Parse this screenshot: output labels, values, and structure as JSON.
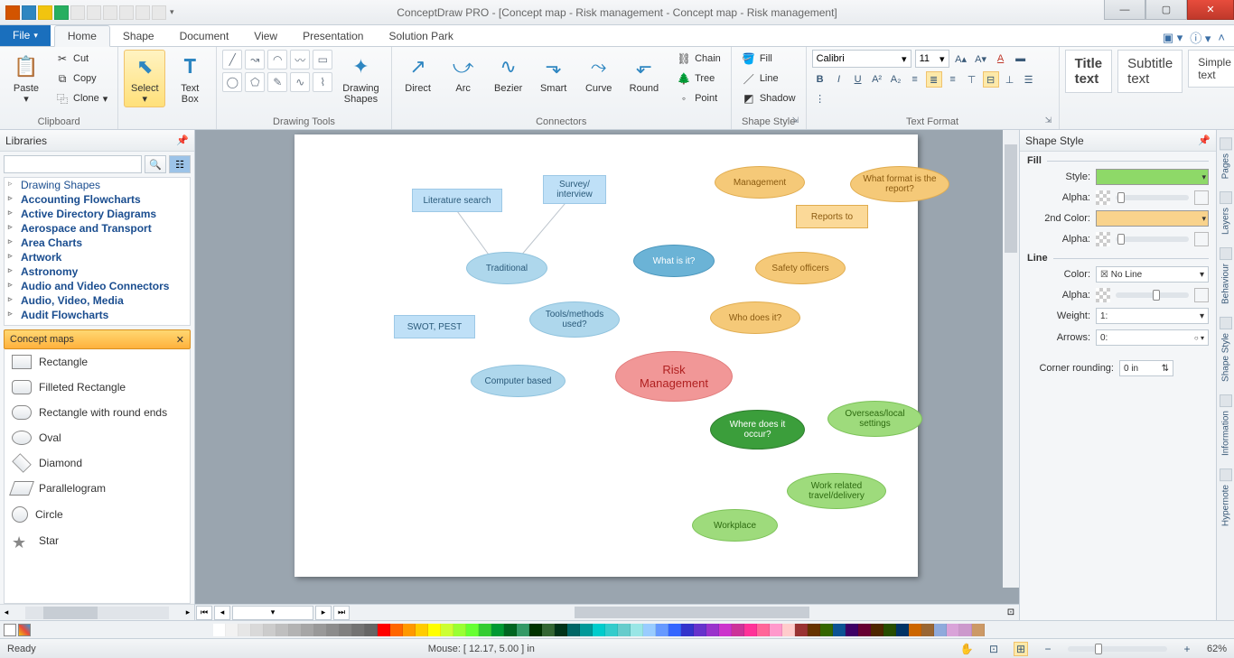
{
  "title": "ConceptDraw PRO - [Concept map - Risk management - Concept map - Risk management]",
  "tabs": {
    "file": "File",
    "home": "Home",
    "shape": "Shape",
    "document": "Document",
    "view": "View",
    "presentation": "Presentation",
    "solution": "Solution Park"
  },
  "ribbon": {
    "clipboard": {
      "label": "Clipboard",
      "paste": "Paste",
      "cut": "Cut",
      "copy": "Copy",
      "clone": "Clone"
    },
    "select": "Select",
    "textbox": "Text\nBox",
    "drawingtools": "Drawing Tools",
    "drawingshapes": "Drawing\nShapes",
    "connectors": {
      "label": "Connectors",
      "direct": "Direct",
      "arc": "Arc",
      "bezier": "Bezier",
      "smart": "Smart",
      "curve": "Curve",
      "round": "Round",
      "chain": "Chain",
      "tree": "Tree",
      "point": "Point"
    },
    "shapestyle": {
      "label": "Shape Style",
      "fill": "Fill",
      "line": "Line",
      "shadow": "Shadow"
    },
    "textformat": {
      "label": "Text Format",
      "font": "Calibri",
      "size": "11"
    },
    "textstyles": {
      "title": "Title\ntext",
      "subtitle": "Subtitle\ntext",
      "simple": "Simple\ntext"
    }
  },
  "libraries": {
    "header": "Libraries",
    "tree": [
      "Drawing Shapes",
      "Accounting Flowcharts",
      "Active Directory Diagrams",
      "Aerospace and Transport",
      "Area Charts",
      "Artwork",
      "Astronomy",
      "Audio and Video Connectors",
      "Audio, Video, Media",
      "Audit Flowcharts"
    ],
    "section": "Concept maps",
    "shapes": [
      "Rectangle",
      "Filleted Rectangle",
      "Rectangle with round ends",
      "Oval",
      "Diamond",
      "Parallelogram",
      "Circle",
      "Star"
    ]
  },
  "canvas": {
    "nodes": {
      "lit": "Literature search",
      "survey": "Survey/\ninterview",
      "mgmt": "Management",
      "format": "What format is the\nreport?",
      "trad": "Traditional",
      "whatis": "What is it?",
      "reports": "Reports to",
      "safety": "Safety officers",
      "swot": "SWOT, PEST",
      "tools": "Tools/methods\nused?",
      "who": "Who does it?",
      "comp": "Computer based",
      "risk": "Risk\nManagement",
      "where": "Where does it\noccur?",
      "overseas": "Overseas/local\nsettings",
      "travel": "Work related\ntravel/delivery",
      "workplace": "Workplace"
    }
  },
  "rightpanel": {
    "header": "Shape Style",
    "fill": "Fill",
    "line": "Line",
    "style": "Style:",
    "alpha": "Alpha:",
    "second": "2nd Color:",
    "color": "Color:",
    "weight": "Weight:",
    "arrows": "Arrows:",
    "corner": "Corner rounding:",
    "noline": "No Line",
    "w": "1:",
    "ar": "0:",
    "cr": "0 in"
  },
  "rail": [
    "Pages",
    "Layers",
    "Behaviour",
    "Shape Style",
    "Information",
    "Hypernote"
  ],
  "statusbar": {
    "ready": "Ready",
    "mouse": "Mouse: [ 12.17, 5.00 ] in",
    "zoom": "62%"
  },
  "palette": [
    "#ffffff",
    "#f2f2f2",
    "#e6e6e6",
    "#d9d9d9",
    "#cccccc",
    "#bfbfbf",
    "#b3b3b3",
    "#a6a6a6",
    "#999999",
    "#8c8c8c",
    "#808080",
    "#737373",
    "#666666",
    "#ff0000",
    "#ff6600",
    "#ff9900",
    "#ffcc00",
    "#ffff00",
    "#ccff33",
    "#99ff33",
    "#66ff33",
    "#33cc33",
    "#009933",
    "#006622",
    "#339966",
    "#003300",
    "#336633",
    "#003319",
    "#006666",
    "#009999",
    "#00cccc",
    "#33cccc",
    "#66cccc",
    "#99e6e6",
    "#99ccff",
    "#6699ff",
    "#3366ff",
    "#3333cc",
    "#6633cc",
    "#9933cc",
    "#cc33cc",
    "#cc3399",
    "#ff3399",
    "#ff6699",
    "#ff99cc",
    "#ffcccc",
    "#993333",
    "#663300",
    "#336600",
    "#0b5394",
    "#3d0066",
    "#660033",
    "#4d2600",
    "#264d00",
    "#003366",
    "#cc6600",
    "#996633",
    "#8faadc",
    "#d9a3d9",
    "#cc99cc",
    "#cc9966"
  ]
}
